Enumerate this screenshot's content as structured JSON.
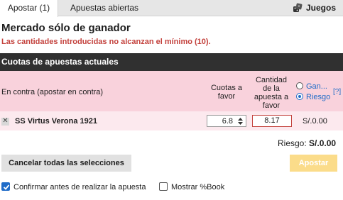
{
  "tabs": {
    "active_label": "Apostar (1)",
    "open_label": "Apuestas abiertas",
    "games_label": "Juegos",
    "games_icon": "dice-icon"
  },
  "market": {
    "title": "Mercado sólo de ganador",
    "warning": "Las cantidades introducidas no alcanzan el mínimo (10)."
  },
  "section": {
    "title": "Cuotas de apuestas actuales"
  },
  "lay_header": {
    "title": "En contra (apostar en contra)",
    "odds_col_line1": "Cuotas a",
    "odds_col_line2": "favor",
    "stake_col_line1": "Cantidad",
    "stake_col_line2": "de la",
    "stake_col_line3": "apuesta a",
    "stake_col_line4": "favor",
    "option_profit": "Gan...",
    "option_risk": "Riesgo",
    "selected_option": "Riesgo",
    "help": "[?]"
  },
  "bet": {
    "remove_icon": "close-icon",
    "remove_glyph": "✕",
    "selection": "SS Virtus Verona 1921",
    "odds": "6.8",
    "stake": "8.17",
    "liability": "S/.0.00"
  },
  "summary": {
    "risk_label": "Riesgo:",
    "risk_value": "S/.0.00"
  },
  "actions": {
    "cancel_all": "Cancelar todas las selecciones",
    "place_bet": "Apostar"
  },
  "options": {
    "confirm_label": "Confirmar antes de realizar la apuesta",
    "confirm_checked": true,
    "book_label": "Mostrar %Book",
    "book_checked": false
  },
  "colors": {
    "lay_bg": "#f9d2dc",
    "lay_row_bg": "#fce9ee",
    "header_bg": "#303030",
    "warning": "#c3413c",
    "accent": "#1f6cc8",
    "place_button": "#fbdc8a"
  }
}
